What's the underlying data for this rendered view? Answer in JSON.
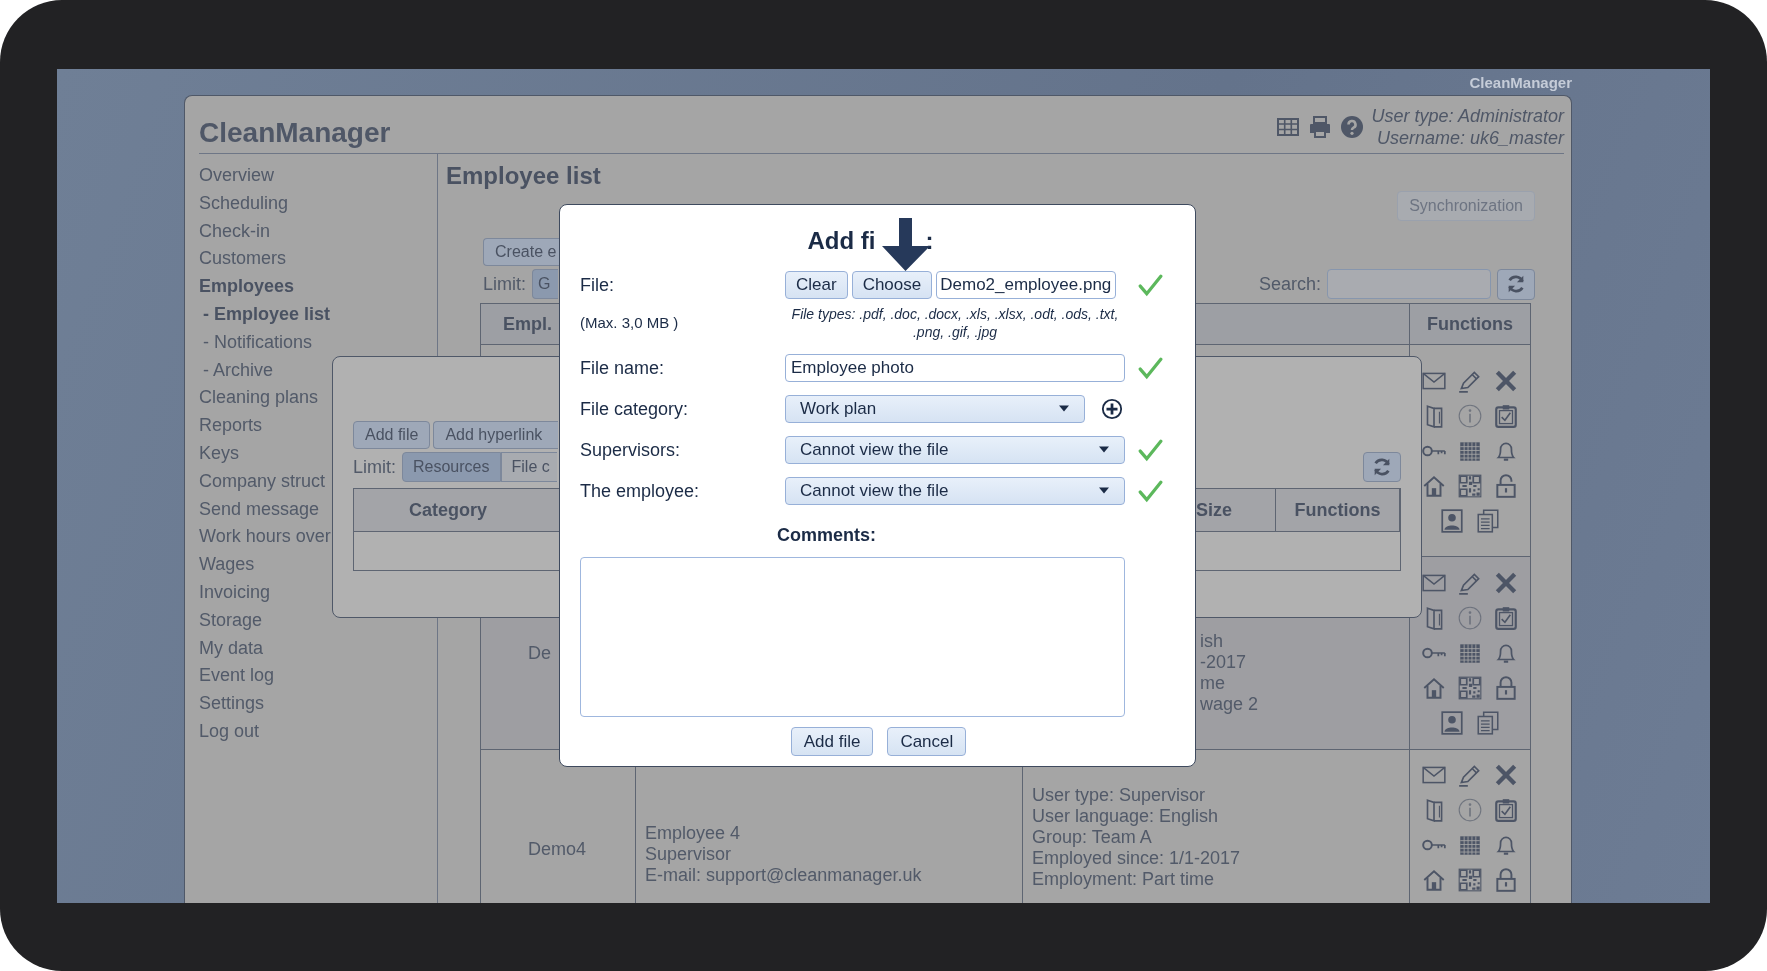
{
  "corner_brand": "CleanManager",
  "header": {
    "title": "CleanManager",
    "user_type": "User type: Administrator",
    "username": "Username: uk6_master"
  },
  "sidebar": {
    "items": [
      {
        "label": "Overview",
        "selected": false
      },
      {
        "label": "Scheduling",
        "selected": false
      },
      {
        "label": "Check-in",
        "selected": false
      },
      {
        "label": "Customers",
        "selected": false
      },
      {
        "label": "Employees",
        "selected": true,
        "children": [
          {
            "label": "- Employee list",
            "selected": true
          },
          {
            "label": "- Notifications",
            "selected": false
          },
          {
            "label": "- Archive",
            "selected": false
          }
        ]
      },
      {
        "label": "Cleaning plans",
        "selected": false
      },
      {
        "label": "Reports",
        "selected": false
      },
      {
        "label": "Keys",
        "selected": false
      },
      {
        "label": "Company struct",
        "selected": false
      },
      {
        "label": "Send message",
        "selected": false
      },
      {
        "label": "Work hours over",
        "selected": false
      },
      {
        "label": "Wages",
        "selected": false
      },
      {
        "label": "Invoicing",
        "selected": false
      },
      {
        "label": "Storage",
        "selected": false
      },
      {
        "label": "My data",
        "selected": false
      },
      {
        "label": "Event log",
        "selected": false
      },
      {
        "label": "Settings",
        "selected": false
      },
      {
        "label": "Log out",
        "selected": false
      }
    ]
  },
  "page": {
    "title": "Employee list",
    "sync_button": {
      "label": "Synchronization",
      "disabled": true
    },
    "create_button": "Create e",
    "limit_label": "Limit:",
    "limit_tabs": [
      {
        "label": "G",
        "selected": true
      }
    ],
    "search_label": "Search:",
    "table": {
      "columns": [
        "Empl.",
        "Functions"
      ],
      "rows": [
        {
          "locked": false
        },
        {
          "locked": true,
          "column_1": "De",
          "column_3": [
            "ish",
            "-2017",
            "me",
            "wage 2"
          ]
        },
        {
          "locked": true,
          "column_1": "Demo4",
          "column_2": [
            "Employee 4",
            "Supervisor",
            "E-mail: support@cleanmanager.uk"
          ],
          "column_3": [
            "User type: Supervisor",
            "User language: English",
            "Group: Team A",
            "Employed since: 1/1-2017",
            "Employment: Part time"
          ]
        }
      ]
    }
  },
  "files_dialog": {
    "buttons": [
      "Add file",
      "Add hyperlink"
    ],
    "limit_label": "Limit:",
    "tabs": [
      {
        "label": "Resources",
        "selected": true
      },
      {
        "label": "File c",
        "selected": false
      }
    ],
    "columns": [
      "Category",
      "Size",
      "Functions"
    ]
  },
  "add_file_dialog": {
    "title": "Add fi",
    "title_end": ":",
    "fields": [
      {
        "kind": "file",
        "label": "File:",
        "note": "(Max. 3,0 MB )",
        "buttons": [
          "Clear",
          "Choose"
        ],
        "value": "Demo2_employee.png",
        "hint": "File types: .pdf, .doc, .docx, .xls, .xlsx, .odt, .ods, .txt, .png, .gif, .jpg",
        "valid": true,
        "addable": false
      },
      {
        "kind": "text",
        "label": "File name:",
        "value": "Employee photo",
        "valid": true,
        "addable": false
      },
      {
        "kind": "select",
        "label": "File category:",
        "value": "Work plan",
        "valid": false,
        "addable": true
      },
      {
        "kind": "select",
        "label": "Supervisors:",
        "value": "Cannot view the file",
        "valid": true,
        "addable": false
      },
      {
        "kind": "select",
        "label": "The employee:",
        "value": "Cannot view the file",
        "valid": true,
        "addable": false
      }
    ],
    "comments_label": "Comments:",
    "buttons": [
      "Add file",
      "Cancel"
    ]
  }
}
